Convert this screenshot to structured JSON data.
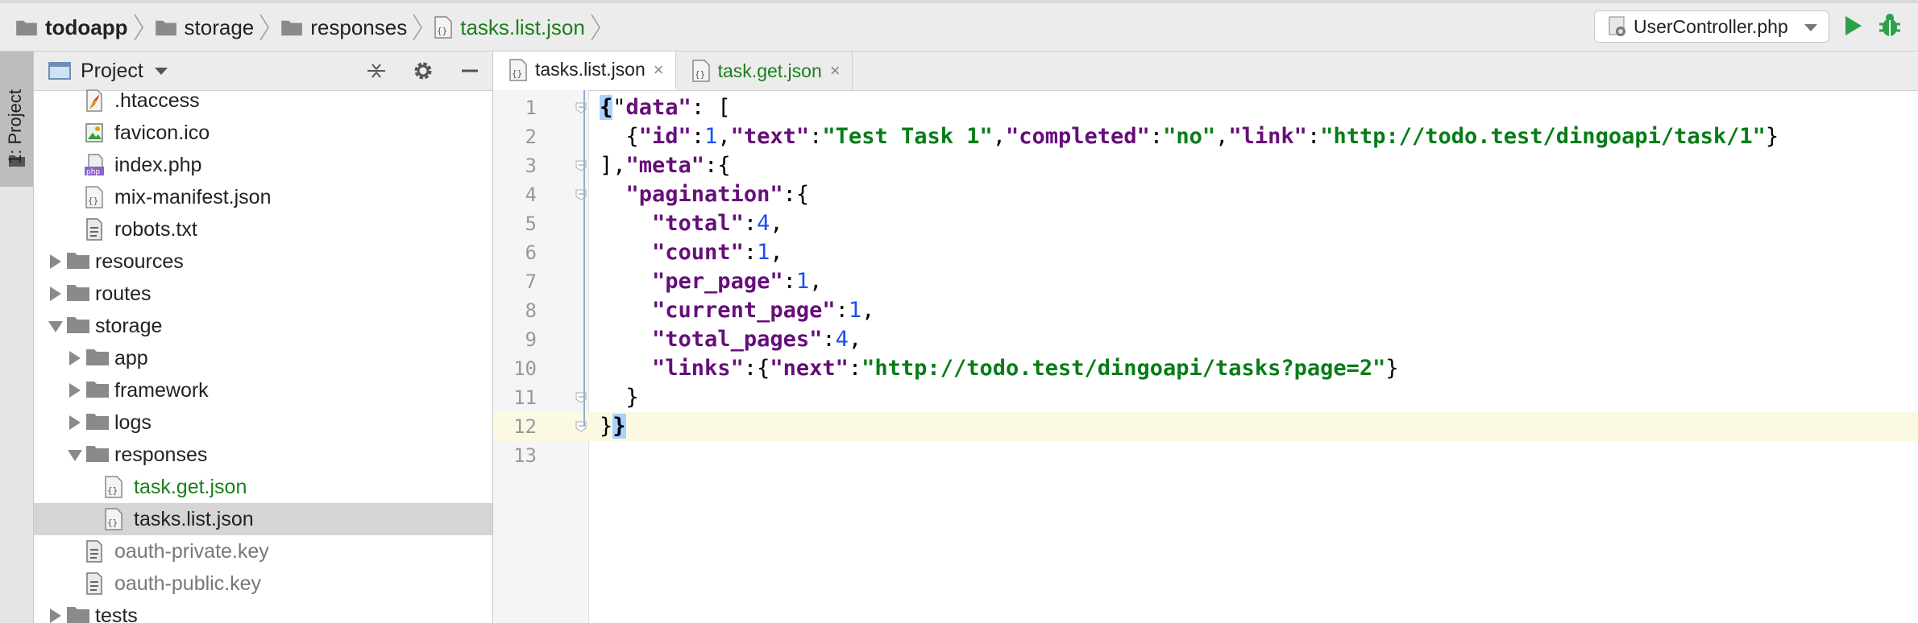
{
  "breadcrumbs": [
    {
      "label": "todoapp",
      "kind": "folder",
      "bold": true
    },
    {
      "label": "storage",
      "kind": "folder",
      "bold": false
    },
    {
      "label": "responses",
      "kind": "folder",
      "bold": false
    },
    {
      "label": "tasks.list.json",
      "kind": "json",
      "bold": false
    }
  ],
  "run_config": {
    "label": "UserController.php"
  },
  "left_strip": {
    "label": "1: Project"
  },
  "project_panel": {
    "title": "Project",
    "tree": [
      {
        "label": ".htaccess",
        "icon": "htaccess-icon",
        "indent": 2,
        "arrow": "none",
        "color": "default"
      },
      {
        "label": "favicon.ico",
        "icon": "image-file-icon",
        "indent": 2,
        "arrow": "none",
        "color": "default"
      },
      {
        "label": "index.php",
        "icon": "php-file-icon",
        "indent": 2,
        "arrow": "none",
        "color": "default"
      },
      {
        "label": "mix-manifest.json",
        "icon": "json-file-icon",
        "indent": 2,
        "arrow": "none",
        "color": "default"
      },
      {
        "label": "robots.txt",
        "icon": "text-file-icon",
        "indent": 2,
        "arrow": "none",
        "color": "default"
      },
      {
        "label": "resources",
        "icon": "folder-icon",
        "indent": 1,
        "arrow": "right",
        "color": "default"
      },
      {
        "label": "routes",
        "icon": "folder-icon",
        "indent": 1,
        "arrow": "right",
        "color": "default"
      },
      {
        "label": "storage",
        "icon": "folder-icon",
        "indent": 1,
        "arrow": "down",
        "color": "default"
      },
      {
        "label": "app",
        "icon": "folder-icon",
        "indent": 2,
        "arrow": "right",
        "color": "default"
      },
      {
        "label": "framework",
        "icon": "folder-icon",
        "indent": 2,
        "arrow": "right",
        "color": "default"
      },
      {
        "label": "logs",
        "icon": "folder-icon",
        "indent": 2,
        "arrow": "right",
        "color": "default"
      },
      {
        "label": "responses",
        "icon": "folder-icon",
        "indent": 2,
        "arrow": "down",
        "color": "default"
      },
      {
        "label": "task.get.json",
        "icon": "json-file-icon",
        "indent": 3,
        "arrow": "none",
        "color": "green"
      },
      {
        "label": "tasks.list.json",
        "icon": "json-file-icon",
        "indent": 3,
        "arrow": "none",
        "color": "default",
        "selected": true
      },
      {
        "label": "oauth-private.key",
        "icon": "text-file-icon",
        "indent": 2,
        "arrow": "none",
        "color": "grey"
      },
      {
        "label": "oauth-public.key",
        "icon": "text-file-icon",
        "indent": 2,
        "arrow": "none",
        "color": "grey"
      },
      {
        "label": "tests",
        "icon": "folder-icon",
        "indent": 1,
        "arrow": "right",
        "color": "default"
      }
    ]
  },
  "editor_tabs": [
    {
      "label": "tasks.list.json",
      "active": true
    },
    {
      "label": "task.get.json",
      "active": false
    }
  ],
  "close_glyph": "×",
  "code_lines": [
    {
      "n": "1",
      "tokens": [
        [
          "h",
          "{"
        ],
        [
          "p",
          "\""
        ],
        [
          "k",
          "data\""
        ],
        [
          "p",
          ": ["
        ]
      ],
      "fold": true
    },
    {
      "n": "2",
      "tokens": [
        [
          "p",
          "  {"
        ],
        [
          "k",
          "\"id\""
        ],
        [
          "p",
          ":"
        ],
        [
          "n",
          "1"
        ],
        [
          "p",
          ","
        ],
        [
          "k",
          "\"text\""
        ],
        [
          "p",
          ":"
        ],
        [
          "s",
          "\"Test Task 1\""
        ],
        [
          "p",
          ","
        ],
        [
          "k",
          "\"completed\""
        ],
        [
          "p",
          ":"
        ],
        [
          "s",
          "\"no\""
        ],
        [
          "p",
          ","
        ],
        [
          "k",
          "\"link\""
        ],
        [
          "p",
          ":"
        ],
        [
          "s",
          "\"http://todo.test/dingoapi/task/1\""
        ],
        [
          "p",
          "}"
        ]
      ]
    },
    {
      "n": "3",
      "tokens": [
        [
          "p",
          "],"
        ],
        [
          "k",
          "\"meta\""
        ],
        [
          "p",
          ":{"
        ]
      ],
      "fold": true
    },
    {
      "n": "4",
      "tokens": [
        [
          "p",
          "  "
        ],
        [
          "k",
          "\"pagination\""
        ],
        [
          "p",
          ":{"
        ]
      ],
      "fold": true
    },
    {
      "n": "5",
      "tokens": [
        [
          "p",
          "    "
        ],
        [
          "k",
          "\"total\""
        ],
        [
          "p",
          ":"
        ],
        [
          "n",
          "4"
        ],
        [
          "p",
          ","
        ]
      ]
    },
    {
      "n": "6",
      "tokens": [
        [
          "p",
          "    "
        ],
        [
          "k",
          "\"count\""
        ],
        [
          "p",
          ":"
        ],
        [
          "n",
          "1"
        ],
        [
          "p",
          ","
        ]
      ]
    },
    {
      "n": "7",
      "tokens": [
        [
          "p",
          "    "
        ],
        [
          "k",
          "\"per_page\""
        ],
        [
          "p",
          ":"
        ],
        [
          "n",
          "1"
        ],
        [
          "p",
          ","
        ]
      ]
    },
    {
      "n": "8",
      "tokens": [
        [
          "p",
          "    "
        ],
        [
          "k",
          "\"current_page\""
        ],
        [
          "p",
          ":"
        ],
        [
          "n",
          "1"
        ],
        [
          "p",
          ","
        ]
      ]
    },
    {
      "n": "9",
      "tokens": [
        [
          "p",
          "    "
        ],
        [
          "k",
          "\"total_pages\""
        ],
        [
          "p",
          ":"
        ],
        [
          "n",
          "4"
        ],
        [
          "p",
          ","
        ]
      ]
    },
    {
      "n": "10",
      "tokens": [
        [
          "p",
          "    "
        ],
        [
          "k",
          "\"links\""
        ],
        [
          "p",
          ":{"
        ],
        [
          "k",
          "\"next\""
        ],
        [
          "p",
          ":"
        ],
        [
          "s",
          "\"http://todo.test/dingoapi/tasks?page=2\""
        ],
        [
          "p",
          "}"
        ]
      ]
    },
    {
      "n": "11",
      "tokens": [
        [
          "p",
          "  }"
        ]
      ],
      "fold": true
    },
    {
      "n": "12",
      "tokens": [
        [
          "p",
          "}"
        ],
        [
          "h",
          "}"
        ]
      ],
      "fold": true,
      "current": true
    },
    {
      "n": "13",
      "tokens": []
    }
  ],
  "colors": {
    "keyword": "#660e7a",
    "string": "#067d17",
    "number": "#1750eb",
    "run": "#2aa14a",
    "current_line": "#fcf9e3",
    "brace_highlight": "#a8d1ff"
  }
}
